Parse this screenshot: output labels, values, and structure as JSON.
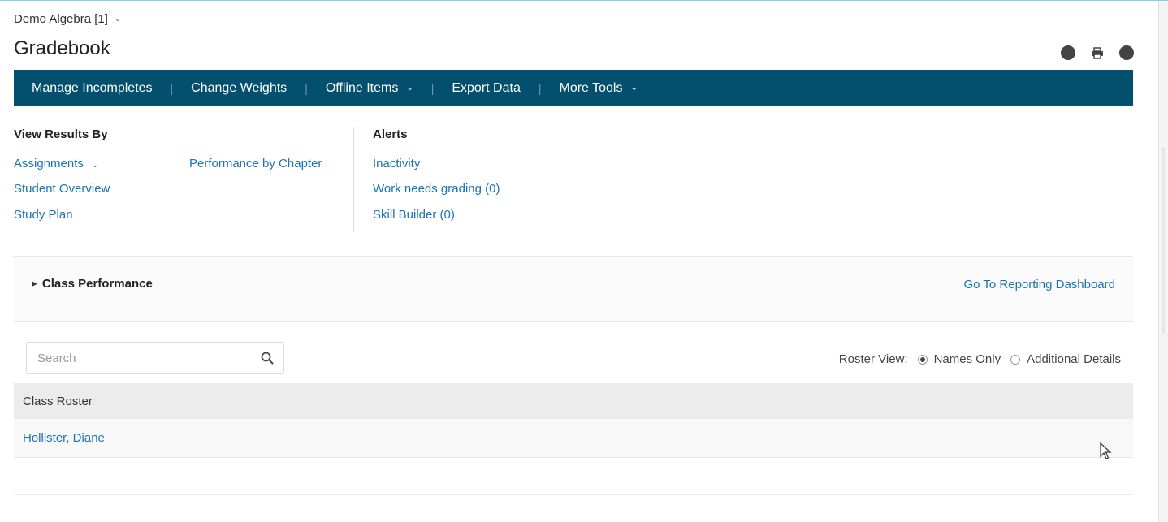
{
  "header": {
    "course_name": "Demo Algebra [1]",
    "page_title": "Gradebook",
    "icons": [
      "info-icon",
      "print-icon",
      "help-icon"
    ]
  },
  "toolbar": {
    "items": [
      {
        "label": "Manage Incompletes",
        "has_dropdown": false
      },
      {
        "label": "Change Weights",
        "has_dropdown": false
      },
      {
        "label": "Offline Items",
        "has_dropdown": true
      },
      {
        "label": "Export Data",
        "has_dropdown": false
      },
      {
        "label": "More Tools",
        "has_dropdown": true
      }
    ],
    "background": "#03506e"
  },
  "view_results": {
    "heading": "View Results By",
    "links": {
      "assignments": "Assignments",
      "student_overview": "Student Overview",
      "study_plan": "Study Plan",
      "performance_by_chapter": "Performance by Chapter"
    }
  },
  "alerts": {
    "heading": "Alerts",
    "links": {
      "inactivity": "Inactivity",
      "work_needs_grading": "Work needs grading (0)",
      "skill_builder": "Skill Builder (0)"
    }
  },
  "class_performance": {
    "title": "Class Performance",
    "dashboard_link": "Go To Reporting Dashboard"
  },
  "search": {
    "placeholder": "Search",
    "value": ""
  },
  "roster_view": {
    "label": "Roster View:",
    "options": [
      {
        "label": "Names Only",
        "selected": true
      },
      {
        "label": "Additional Details",
        "selected": false
      }
    ]
  },
  "roster": {
    "header": "Class Roster",
    "students": [
      "Hollister, Diane"
    ]
  },
  "colors": {
    "link": "#1a73b3",
    "toolbar": "#03506e"
  }
}
